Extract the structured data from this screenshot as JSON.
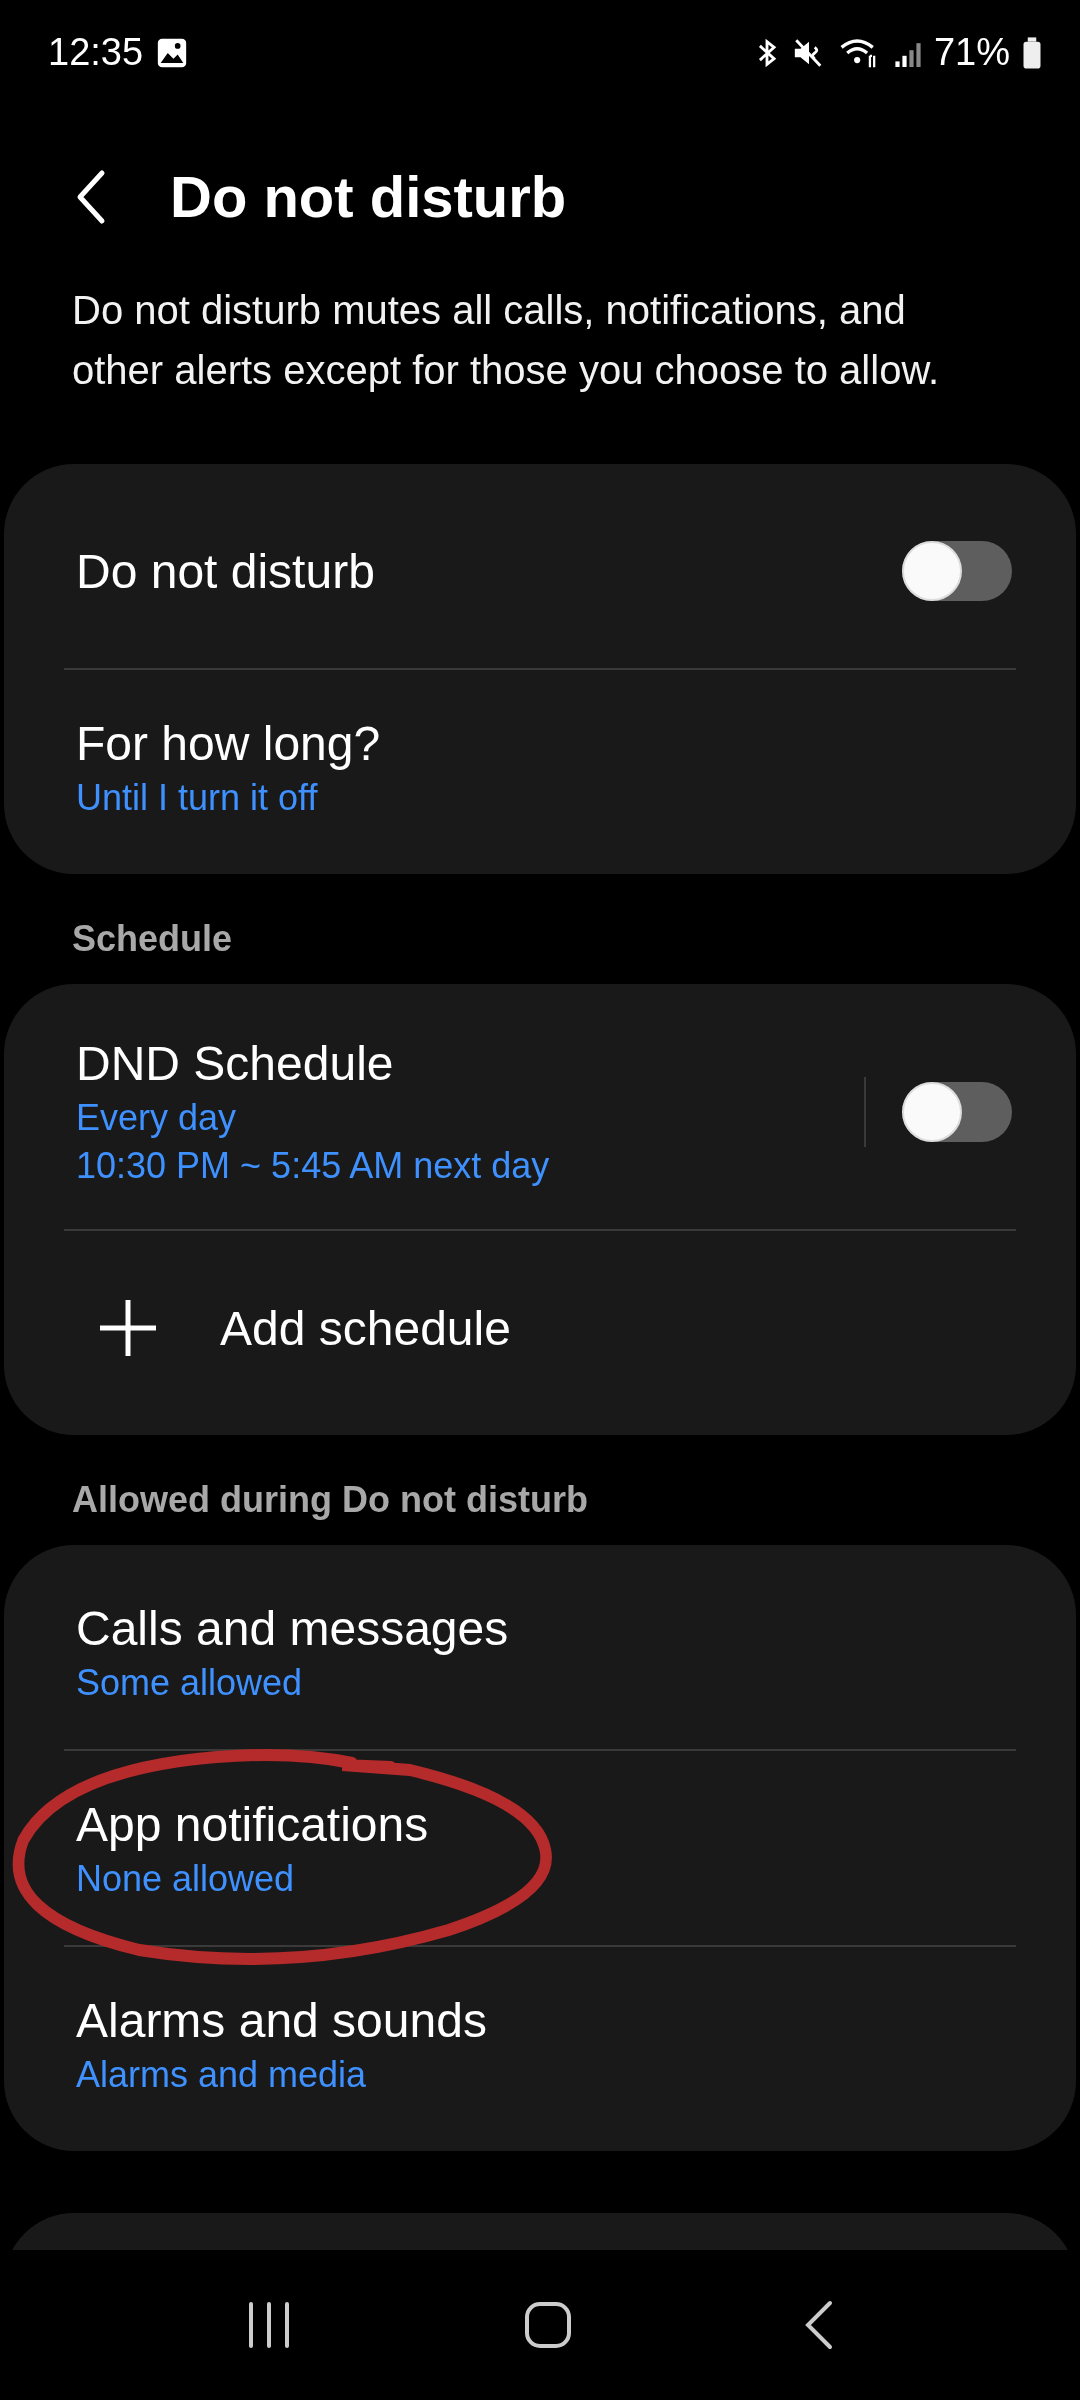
{
  "status_bar": {
    "time": "12:35",
    "battery": "71%"
  },
  "header": {
    "title": "Do not disturb"
  },
  "description": "Do not disturb mutes all calls, notifications, and other alerts except for those you choose to allow.",
  "main_card": {
    "rows": [
      {
        "kind": "toggle",
        "title": "Do not disturb",
        "on": false
      },
      {
        "title": "For how long?",
        "subtitle": "Until I turn it off"
      }
    ]
  },
  "schedule": {
    "heading": "Schedule",
    "rows": [
      {
        "kind": "toggle",
        "title": "DND Schedule",
        "subtitle": "Every day",
        "detail": "10:30 PM ~ 5:45 AM next day",
        "on": false
      },
      {
        "kind": "add",
        "title": "Add schedule"
      }
    ]
  },
  "allowed": {
    "heading": "Allowed during Do not disturb",
    "rows": [
      {
        "title": "Calls and messages",
        "subtitle": "Some allowed",
        "circled": false
      },
      {
        "title": "App notifications",
        "subtitle": "None allowed",
        "circled": true
      },
      {
        "title": "Alarms and sounds",
        "subtitle": "Alarms and media",
        "circled": false
      }
    ]
  }
}
